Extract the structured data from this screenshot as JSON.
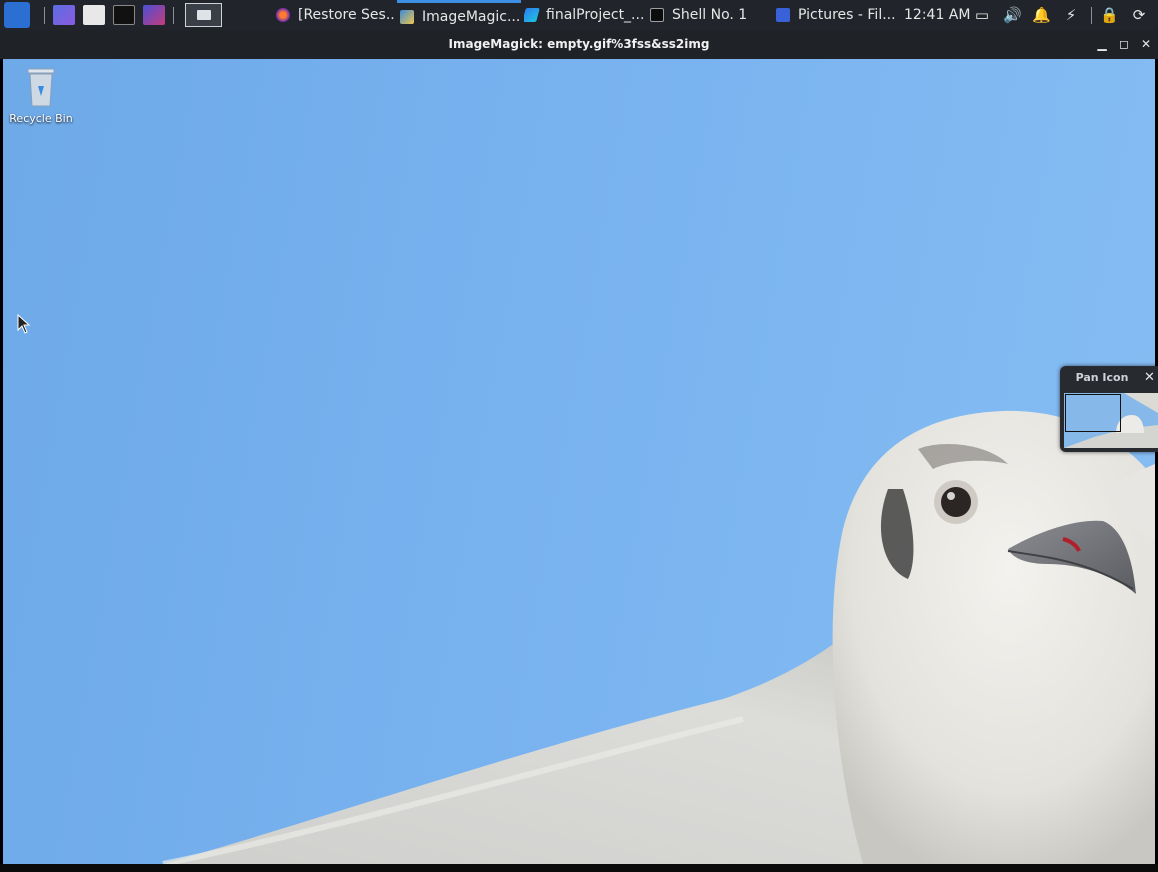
{
  "taskbar": {
    "tasks": [
      {
        "label": "[Restore Ses...",
        "icon": "firefox-icon"
      },
      {
        "label": "ImageMagic...",
        "icon": "imagemagick-icon",
        "active": true
      },
      {
        "label": "finalProject_...",
        "icon": "pycharm-icon"
      },
      {
        "label": "Shell No. 1",
        "icon": "terminal-icon"
      },
      {
        "label": "Pictures - Fil...",
        "icon": "file-manager-icon"
      }
    ],
    "clock": "12:41 AM"
  },
  "window": {
    "title": "ImageMagick: empty.gif%3fss&ss2img"
  },
  "desktop": {
    "recycle_bin_label": "Recycle Bin"
  },
  "pan_icon": {
    "title": "Pan Icon",
    "close": "✕"
  },
  "colors": {
    "sky": "#78b2ef",
    "taskbar": "#21252b",
    "accent": "#3d8fe6"
  }
}
